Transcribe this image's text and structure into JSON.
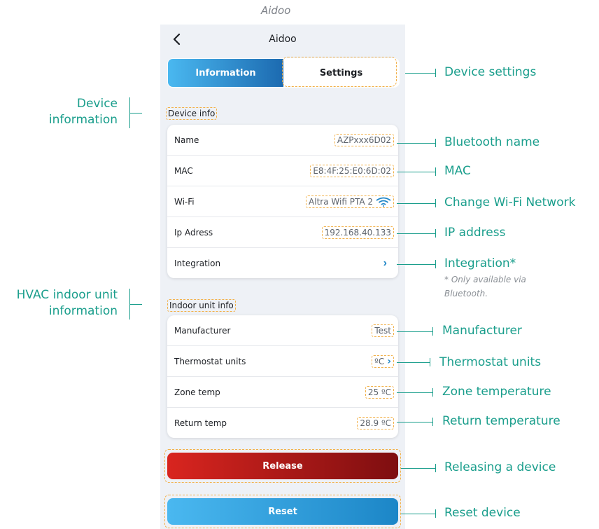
{
  "caption": "Aidoo",
  "header": {
    "title": "Aidoo",
    "back_icon": "chevron-left-icon"
  },
  "tabs": [
    {
      "label": "Information",
      "active": true
    },
    {
      "label": "Settings",
      "active": false
    }
  ],
  "device_info": {
    "section_label": "Device info",
    "rows": [
      {
        "label": "Name",
        "value": "AZPxxx6D02"
      },
      {
        "label": "MAC",
        "value": "E8:4F:25:E0:6D:02"
      },
      {
        "label": "Wi-Fi",
        "value": "Altra Wifi PTA 2",
        "icon": "wifi-icon"
      },
      {
        "label": "Ip Adress",
        "value": "192.168.40.133"
      },
      {
        "label": "Integration",
        "icon": "chevron-right-icon"
      }
    ]
  },
  "indoor_info": {
    "section_label": "Indoor unit info",
    "rows": [
      {
        "label": "Manufacturer",
        "value": "Test"
      },
      {
        "label": "Thermostat units",
        "value": "ºC"
      },
      {
        "label": "Zone temp",
        "value": "25 ºC"
      },
      {
        "label": "Return temp",
        "value": "28.9 ºC"
      }
    ]
  },
  "buttons": {
    "release": "Release",
    "reset": "Reset"
  },
  "annotations": {
    "device_settings": "Device settings",
    "bluetooth_name": "Bluetooth name",
    "mac": "MAC",
    "change_wifi": "Change Wi-Fi Network",
    "ip_address": "IP address",
    "integration": "Integration*",
    "integration_note_1": "* Only available via",
    "integration_note_2": "Bluetooth.",
    "manufacturer": "Manufacturer",
    "thermostat_units": "Thermostat units",
    "zone_temperature": "Zone temperature",
    "return_temperature": "Return temperature",
    "releasing": "Releasing a device",
    "reset_device": "Reset device",
    "device_information_1": "Device",
    "device_information_2": "information",
    "hvac_1": "HVAC indoor unit",
    "hvac_2": "information"
  },
  "colors": {
    "accent_teal": "#1a9e8c",
    "highlight_orange": "#f2b14a",
    "primary_blue": "#1f86c7",
    "release_red": "#c81d1a"
  }
}
